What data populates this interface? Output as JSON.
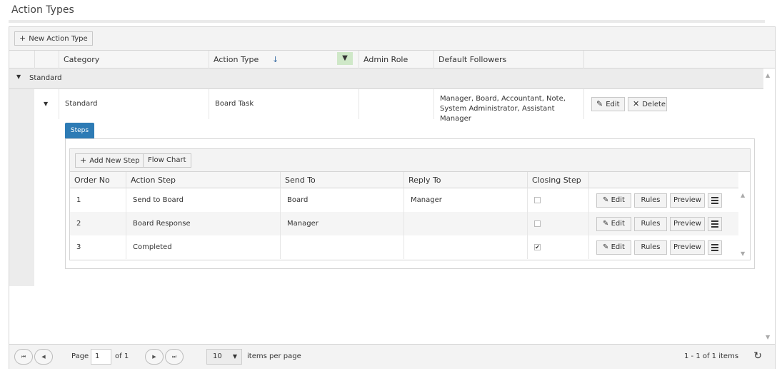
{
  "page": {
    "title": "Action Types"
  },
  "toolbar": {
    "new_button": "New Action Type",
    "plus": "+"
  },
  "columns": {
    "category": "Category",
    "action_type": "Action Type",
    "sort_arrow": "↓",
    "filter_icon": "▼",
    "admin_role": "Admin Role",
    "default_followers": "Default Followers"
  },
  "group": {
    "toggle": "▼",
    "label": "Standard"
  },
  "row": {
    "toggle": "▼",
    "category": "Standard",
    "action_type": "Board Task",
    "admin_role": "",
    "default_followers": "Manager, Board, Accountant, Note, System Administrator, Assistant Manager",
    "edit": "Edit",
    "delete": "Delete",
    "edit_icon": "✎",
    "delete_icon": "✕"
  },
  "tab": {
    "label": "Steps"
  },
  "steps_toolbar": {
    "add": "Add New Step",
    "plus": "+",
    "flow": "Flow Chart"
  },
  "steps_columns": {
    "order_no": "Order No",
    "action_step": "Action Step",
    "send_to": "Send To",
    "reply_to": "Reply To",
    "closing_step": "Closing Step"
  },
  "steps": [
    {
      "order": "1",
      "step": "Send to Board",
      "send_to": "Board",
      "reply_to": "Manager",
      "closing": false
    },
    {
      "order": "2",
      "step": "Board Response",
      "send_to": "Manager",
      "reply_to": "",
      "closing": false
    },
    {
      "order": "3",
      "step": "Completed",
      "send_to": "",
      "reply_to": "",
      "closing": true
    }
  ],
  "step_buttons": {
    "edit": "Edit",
    "rules": "Rules",
    "preview": "Preview",
    "edit_icon": "✎",
    "check_mark": "✔"
  },
  "pager": {
    "first": "⏮",
    "prev": "◀",
    "next": "▶",
    "last": "⏭",
    "page_label": "Page",
    "page_value": "1",
    "of_label": "of 1",
    "per_page_value": "10",
    "per_page_caret": "▼",
    "per_page_label": "items per page",
    "summary": "1 - 1 of 1 items",
    "refresh": "↻"
  },
  "scroll": {
    "up": "▲",
    "down": "▼"
  }
}
